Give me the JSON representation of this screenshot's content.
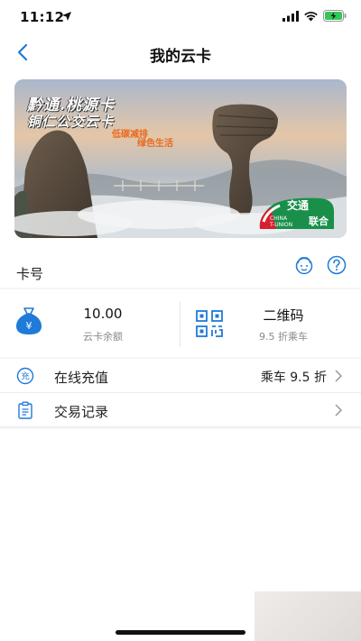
{
  "status": {
    "time": "11:12"
  },
  "nav": {
    "title": "我的云卡"
  },
  "card": {
    "title_line1": "黔通.桃源卡",
    "title_line2": "铜仁公交云卡",
    "slogan_line1": "低碳减排",
    "slogan_line2": "绿色生活",
    "logo_chinese_top": "交通",
    "logo_chinese_bottom": "联合",
    "logo_english_top": "CHINA",
    "logo_english_bottom": "T-UNION",
    "number_label": "卡号"
  },
  "balance": {
    "value": "10.00",
    "label": "云卡余额"
  },
  "qrcode": {
    "label": "二维码",
    "sub": "9.5 折乘车"
  },
  "list": {
    "items": [
      {
        "icon": "recharge-icon",
        "icon_text": "充",
        "label": "在线充值",
        "extra": "乘车 9.5 折"
      },
      {
        "icon": "clipboard-icon",
        "label": "交易记录",
        "extra": ""
      }
    ]
  },
  "colors": {
    "accent": "#1f7ad8",
    "background": "#f4f5f7"
  }
}
